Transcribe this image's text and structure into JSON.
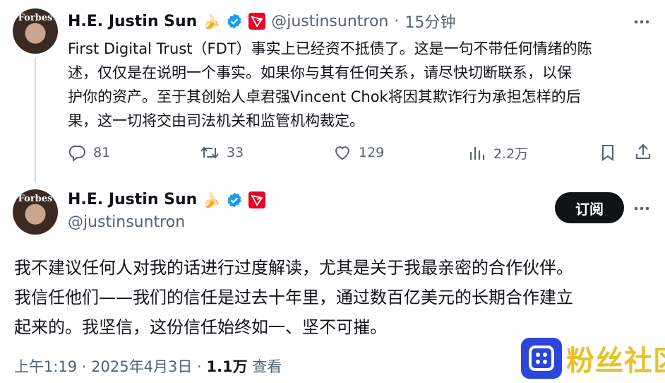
{
  "quoted_post": {
    "author_name": "H.E. Justin Sun",
    "author_emoji": "🍌",
    "handle": "@justinsuntron",
    "separator": "·",
    "time_ago": "15分钟",
    "avatar_brand": "Forbes",
    "text_lines": [
      "First Digital Trust（FDT）事实上已经资不抵债了。这是一句不带任何情绪的陈",
      "述，仅仅是在说明一个事实。如果你与其有任何关系，请尽快切断联系，以保",
      "护你的资产。至于其创始人卓君强Vincent Chok将因其欺诈行为承担怎样的后",
      "果，这一切将交由司法机关和监管机构裁定。"
    ],
    "actions": {
      "replies": "81",
      "reposts": "33",
      "likes": "129",
      "views": "2.2万"
    }
  },
  "main_post": {
    "author_name": "H.E. Justin Sun",
    "author_emoji": "🍌",
    "handle": "@justinsuntron",
    "avatar_brand": "Forbes",
    "subscribe_label": "订阅",
    "text_lines": [
      "我不建议任何人对我的话进行过度解读，尤其是关于我最亲密的合作伙伴。",
      "我信任他们——我们的信任是过去十年里，通过数百亿美元的长期合作建立",
      "起来的。我坚信，这份信任始终如一、坚不可摧。"
    ],
    "timestamp": "上午1:19 · 2025年4月3日 · ",
    "views_count": "1.1万",
    "views_label": " 查看"
  },
  "watermark": {
    "text": "粉丝社区"
  },
  "colors": {
    "verified": "#1d9bf0",
    "tron_red": "#eb0029",
    "secondary_text": "#536471",
    "watermark_blue": "#2b46d8",
    "watermark_yellow": "#e8c12a"
  }
}
